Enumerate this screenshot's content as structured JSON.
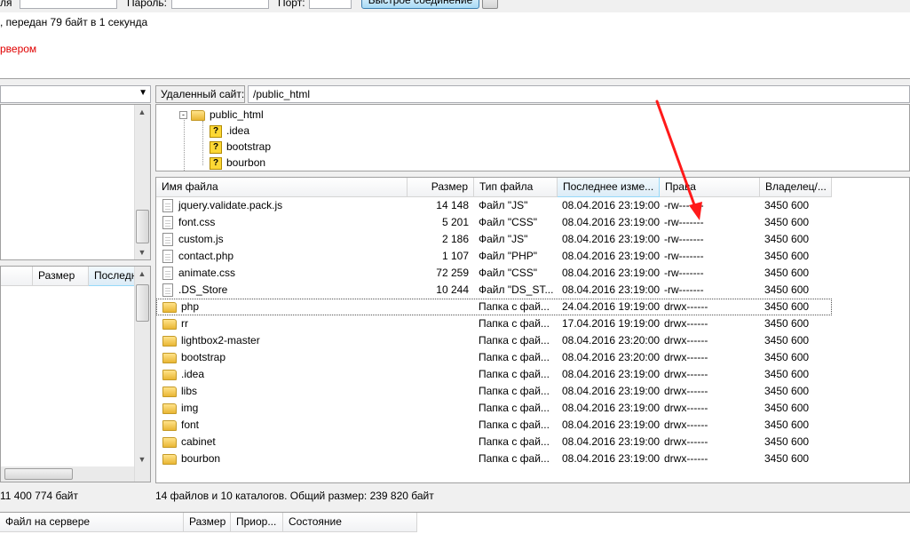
{
  "quickconnect": {
    "host_label_fragment": "ля",
    "password_label": "Пароль:",
    "port_label": "Порт:",
    "connect_button": "Быстрое соединение"
  },
  "log": {
    "line1": ", передан 79 байт в 1 секунда",
    "line2": "рвером",
    "error_color": "#e00000"
  },
  "local": {
    "columns": [
      "Размер",
      "Последн"
    ],
    "status": "11 400 774 байт"
  },
  "remote": {
    "site_label": "Удаленный сайт:",
    "path": "/public_html",
    "tree": [
      {
        "label": "public_html",
        "icon": "folder-open-icon"
      },
      {
        "label": ".idea",
        "icon": "unknown-folder-icon"
      },
      {
        "label": "bootstrap",
        "icon": "unknown-folder-icon"
      },
      {
        "label": "bourbon",
        "icon": "unknown-folder-icon"
      }
    ],
    "columns": [
      "Имя файла",
      "Размер",
      "Тип файла",
      "Последнее изме...",
      "Права",
      "Владелец/..."
    ],
    "files": [
      {
        "name": "jquery.validate.pack.js",
        "size": "14 148",
        "type": "Файл \"JS\"",
        "modified": "08.04.2016 23:19:00",
        "perms": "-rw-------",
        "owner": "3450 600",
        "kind": "file"
      },
      {
        "name": "font.css",
        "size": "5 201",
        "type": "Файл \"CSS\"",
        "modified": "08.04.2016 23:19:00",
        "perms": "-rw-------",
        "owner": "3450 600",
        "kind": "file"
      },
      {
        "name": "custom.js",
        "size": "2 186",
        "type": "Файл \"JS\"",
        "modified": "08.04.2016 23:19:00",
        "perms": "-rw-------",
        "owner": "3450 600",
        "kind": "file"
      },
      {
        "name": "contact.php",
        "size": "1 107",
        "type": "Файл \"PHP\"",
        "modified": "08.04.2016 23:19:00",
        "perms": "-rw-------",
        "owner": "3450 600",
        "kind": "file"
      },
      {
        "name": "animate.css",
        "size": "72 259",
        "type": "Файл \"CSS\"",
        "modified": "08.04.2016 23:19:00",
        "perms": "-rw-------",
        "owner": "3450 600",
        "kind": "file"
      },
      {
        "name": ".DS_Store",
        "size": "10 244",
        "type": "Файл \"DS_ST...",
        "modified": "08.04.2016 23:19:00",
        "perms": "-rw-------",
        "owner": "3450 600",
        "kind": "file"
      },
      {
        "name": "php",
        "size": "",
        "type": "Папка с фай...",
        "modified": "24.04.2016 19:19:00",
        "perms": "drwx------",
        "owner": "3450 600",
        "kind": "folder",
        "selected": true
      },
      {
        "name": "rr",
        "size": "",
        "type": "Папка с фай...",
        "modified": "17.04.2016 19:19:00",
        "perms": "drwx------",
        "owner": "3450 600",
        "kind": "folder"
      },
      {
        "name": "lightbox2-master",
        "size": "",
        "type": "Папка с фай...",
        "modified": "08.04.2016 23:20:00",
        "perms": "drwx------",
        "owner": "3450 600",
        "kind": "folder"
      },
      {
        "name": "bootstrap",
        "size": "",
        "type": "Папка с фай...",
        "modified": "08.04.2016 23:20:00",
        "perms": "drwx------",
        "owner": "3450 600",
        "kind": "folder"
      },
      {
        "name": ".idea",
        "size": "",
        "type": "Папка с фай...",
        "modified": "08.04.2016 23:19:00",
        "perms": "drwx------",
        "owner": "3450 600",
        "kind": "folder"
      },
      {
        "name": "libs",
        "size": "",
        "type": "Папка с фай...",
        "modified": "08.04.2016 23:19:00",
        "perms": "drwx------",
        "owner": "3450 600",
        "kind": "folder"
      },
      {
        "name": "img",
        "size": "",
        "type": "Папка с фай...",
        "modified": "08.04.2016 23:19:00",
        "perms": "drwx------",
        "owner": "3450 600",
        "kind": "folder"
      },
      {
        "name": "font",
        "size": "",
        "type": "Папка с фай...",
        "modified": "08.04.2016 23:19:00",
        "perms": "drwx------",
        "owner": "3450 600",
        "kind": "folder"
      },
      {
        "name": "cabinet",
        "size": "",
        "type": "Папка с фай...",
        "modified": "08.04.2016 23:19:00",
        "perms": "drwx------",
        "owner": "3450 600",
        "kind": "folder"
      },
      {
        "name": "bourbon",
        "size": "",
        "type": "Папка с фай...",
        "modified": "08.04.2016 23:19:00",
        "perms": "drwx------",
        "owner": "3450 600",
        "kind": "folder"
      }
    ],
    "status": "14 файлов и 10 каталогов. Общий размер: 239 820 байт"
  },
  "queue": {
    "columns": [
      "Файл на сервере",
      "Размер",
      "Приор...",
      "Состояние"
    ]
  },
  "annotation_color": "#ff0000"
}
